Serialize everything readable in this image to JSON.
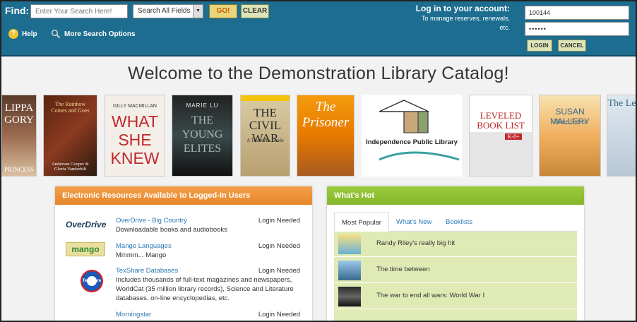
{
  "header": {
    "find_label": "Find:",
    "search_placeholder": "Enter Your Search Here!",
    "search_scope": "Search All Fields",
    "go_label": "GO!",
    "clear_label": "CLEAR",
    "help_label": "Help",
    "more_search_label": "More Search Options",
    "login_title": "Log in to your account:",
    "login_subtitle": "To manage reserves, renewals, etc.",
    "username_value": "100144",
    "password_value": "••••••",
    "login_button": "LOGIN",
    "cancel_button": "CANCEL",
    "colors": {
      "header_bg": "#1c6d8f",
      "go_bg": "#e9d57a"
    }
  },
  "welcome": "Welcome to the Demonstration Library Catalog!",
  "covers": [
    {
      "title": "LIPPA GORY",
      "sub": "PRINCESS"
    },
    {
      "title": "The Rainbow Comes and Goes",
      "sub": "Anderson Cooper & Gloria Vanderbilt"
    },
    {
      "title": "WHAT SHE KNEW",
      "sub": "GILLY MACMILLAN"
    },
    {
      "title": "THE YOUNG ELITES",
      "sub": "MARIE LU"
    },
    {
      "title": "THE CIVIL WAR",
      "sub": "A Traveler's Guide"
    },
    {
      "title": "The Prisoner",
      "sub": ""
    },
    {
      "title": "Independence Public Library",
      "sub": ""
    },
    {
      "title": "LEVELED BOOK LIST",
      "sub": "K-8+"
    },
    {
      "title": "SUSAN MALLERY",
      "sub": "Three Sisters"
    },
    {
      "title": "The Le",
      "sub": ""
    }
  ],
  "electronic_resources": {
    "heading": "Electronic Resources Available to Logged-In Users",
    "items": [
      {
        "logo": "OverDrive",
        "title": "OverDrive - Big Country",
        "desc": "Downloadable books and audiobooks",
        "status": "Login Needed"
      },
      {
        "logo": "mango",
        "title": "Mango Languages",
        "desc": "Mmmm... Mango",
        "status": "Login Needed"
      },
      {
        "logo": "TexShare",
        "title": "TexShare Databases",
        "desc": "Includes thousands of full-text magazines and newspapers, WorldCat (35 million library records), Science and Literature databases, on-line encyclopedias, etc.",
        "status": "Login Needed"
      },
      {
        "logo": "",
        "title": "Morningstar",
        "desc": "",
        "status": "Login Needed"
      }
    ]
  },
  "whats_hot": {
    "heading": "What's Hot",
    "tabs": [
      "Most Popular",
      "What's New",
      "Booklists"
    ],
    "items": [
      {
        "title": "Randy Riley's really big hit"
      },
      {
        "title": "The time between"
      },
      {
        "title": "The war to end all wars: World War I"
      }
    ]
  }
}
